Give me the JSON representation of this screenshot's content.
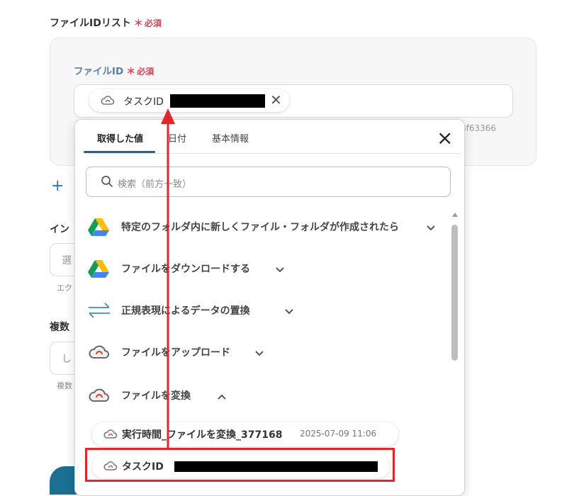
{
  "form": {
    "section_label": "ファイルIDリスト",
    "required_mark": "＊",
    "required_text": "必須",
    "field_label": "ファイルID",
    "chip": {
      "icon": "cloud-icon",
      "label": "タスクID"
    },
    "hint_tail": "8f63366",
    "add_button_label": "+",
    "add_button_text_cut": "",
    "field2_label_cut": "イン",
    "field2_placeholder_cut": "選",
    "field2_help_cut": "エク",
    "field3_label_cut": "複数",
    "field3_placeholder_cut": "し",
    "field3_help_cut": "複数"
  },
  "dropdown": {
    "tabs": [
      "取得した値",
      "日付",
      "基本情報"
    ],
    "active_tab": 0,
    "search_placeholder": "検索（前方一致）",
    "close_label": "×",
    "items": [
      {
        "icon": "google-drive-icon",
        "label": "特定のフォルダ内に新しくファイル・フォルダが作成されたら",
        "expanded": false
      },
      {
        "icon": "google-drive-icon",
        "label": "ファイルをダウンロードする",
        "expanded": false
      },
      {
        "icon": "regex-arrows-icon",
        "label": "正規表現によるデータの置換",
        "expanded": false
      },
      {
        "icon": "cloud-convert-icon",
        "label": "ファイルをアップロード",
        "expanded": false
      },
      {
        "icon": "cloud-convert-icon",
        "label": "ファイルを変換",
        "expanded": true
      }
    ],
    "subitems": [
      {
        "icon": "cloud-icon",
        "label": "実行時間_ファイルを変換_377168",
        "value": "2025-07-09 11:06"
      },
      {
        "icon": "cloud-icon",
        "label": "タスクID",
        "value": ""
      }
    ]
  },
  "colors": {
    "required": "#e23c4e",
    "field_label": "#5a7fa8",
    "tab_underline": "#2c5e86",
    "annotation_red": "#e4262a",
    "primary_button": "#1b6f93"
  }
}
